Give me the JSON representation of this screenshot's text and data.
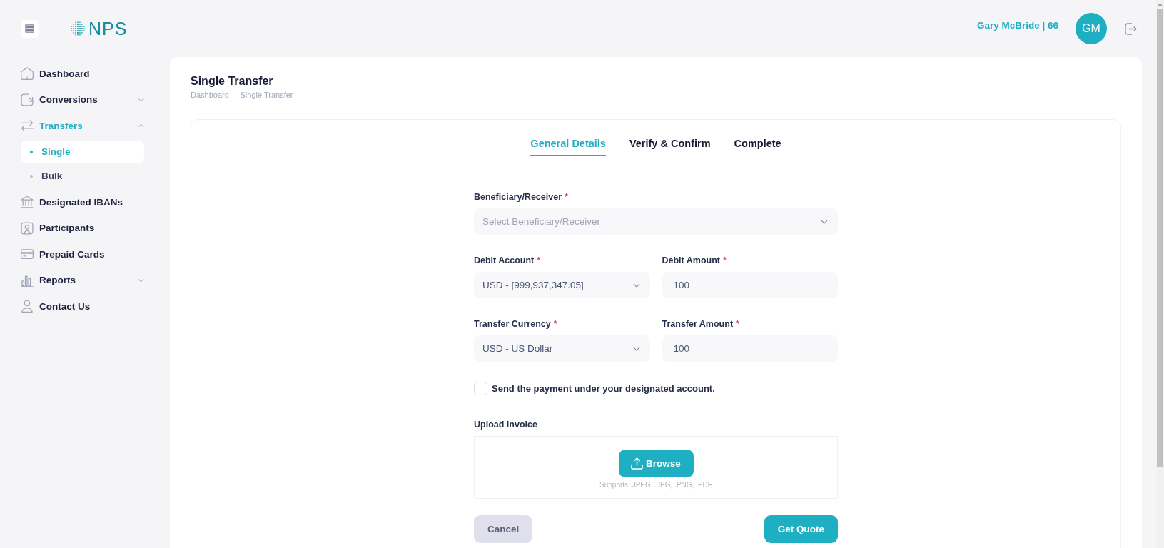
{
  "header": {
    "logo": "NPS",
    "user": "Gary McBride | 66",
    "avatar": "GM"
  },
  "sidebar": {
    "items": [
      {
        "label": "Dashboard",
        "kind": "link",
        "selected": false
      },
      {
        "label": "Conversions",
        "kind": "group",
        "selected": false,
        "expanded": false
      },
      {
        "label": "Transfers",
        "kind": "group",
        "selected": true,
        "expanded": true,
        "children": [
          {
            "label": "Single",
            "selected": true
          },
          {
            "label": "Bulk",
            "selected": false
          }
        ]
      },
      {
        "label": "Designated IBANs",
        "kind": "link",
        "selected": false
      },
      {
        "label": "Participants",
        "kind": "link",
        "selected": false
      },
      {
        "label": "Prepaid Cards",
        "kind": "link",
        "selected": false
      },
      {
        "label": "Reports",
        "kind": "group",
        "selected": false,
        "expanded": false
      },
      {
        "label": "Contact Us",
        "kind": "link",
        "selected": false
      }
    ]
  },
  "page": {
    "title": "Single Transfer",
    "breadcrumb": {
      "items": [
        "Dashboard",
        "Single Transfer"
      ],
      "separator": "-"
    }
  },
  "tabs": [
    {
      "label": "General Details",
      "selected": true
    },
    {
      "label": "Verify & Confirm",
      "selected": false
    },
    {
      "label": "Complete",
      "selected": false
    }
  ],
  "form": {
    "rows": [
      {
        "fields": [
          {
            "kind": "select",
            "label": "Beneficiary/Receiver",
            "required_mark": "*",
            "placeholder": "Select Beneficiary/Receiver"
          }
        ]
      },
      {
        "fields": [
          {
            "kind": "select",
            "label": "Debit Account",
            "required_mark": "*",
            "value": "USD - [999,937,347.05]"
          },
          {
            "kind": "input",
            "label": "Debit Amount",
            "required_mark": "*",
            "value": "100"
          }
        ]
      },
      {
        "fields": [
          {
            "kind": "select",
            "label": "Transfer Currency",
            "required_mark": "*",
            "value": "USD - US Dollar"
          },
          {
            "kind": "input",
            "label": "Transfer Amount",
            "required_mark": "*",
            "value": "100"
          }
        ]
      }
    ],
    "checkbox": {
      "label": "Send the payment under your designated account.",
      "checked": false
    },
    "upload": {
      "label": "Upload Invoice",
      "button": "Browse",
      "hint": "Supports .JPEG, .JPG, .PNG, .PDF"
    },
    "buttons": [
      {
        "label": "Cancel",
        "kind": "secondary"
      },
      {
        "label": "Get Quote",
        "kind": "primary"
      }
    ]
  }
}
